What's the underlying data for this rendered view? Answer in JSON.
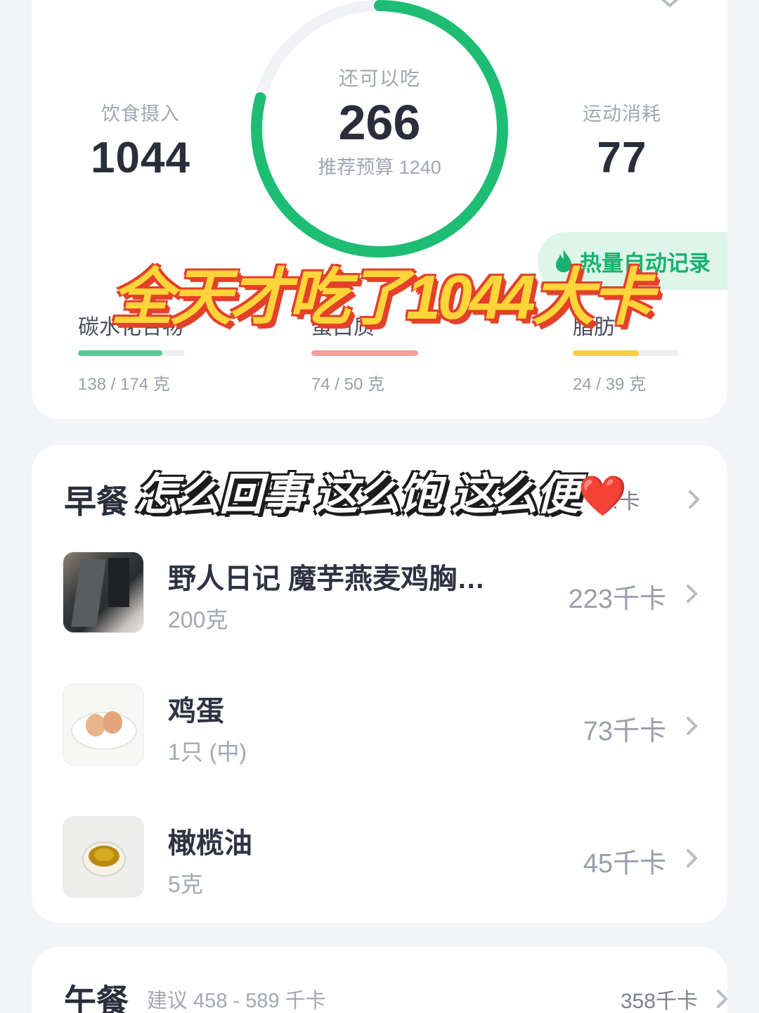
{
  "summary": {
    "intake_label": "饮食摄入",
    "intake_value": "1044",
    "remaining_label": "还可以吃",
    "remaining_value": "266",
    "budget_text": "推荐预算 1240",
    "remaining_fraction": 0.79,
    "burn_label": "运动消耗",
    "burn_value": "77",
    "auto_record_label": "热量自动记录",
    "ring_color": "#1dbd74"
  },
  "macros": [
    {
      "name": "碳水化合物",
      "amount": "138 / 174 克",
      "fraction": 0.79,
      "color": "#56c98e"
    },
    {
      "name": "蛋白质",
      "amount": "74 / 50 克",
      "fraction": 1.0,
      "color": "#f4a09a"
    },
    {
      "name": "脂肪",
      "amount": "24 / 39 克",
      "fraction": 0.62,
      "color": "#f7cf3e"
    }
  ],
  "overlays": {
    "headline": "全天才吃了1044大卡",
    "subline": "怎么回事 这么饱 这么便",
    "heart": "❤️"
  },
  "breakfast": {
    "title": "早餐",
    "total": "…卡",
    "items": [
      {
        "name": "野人日记 魔芋燕麦鸡胸…",
        "amount": "200克",
        "kcal": "223千卡",
        "icon": "packaged-food-thumb"
      },
      {
        "name": "鸡蛋",
        "amount": "1只 (中)",
        "kcal": "73千卡",
        "icon": "egg-thumb"
      },
      {
        "name": "橄榄油",
        "amount": "5克",
        "kcal": "45千卡",
        "icon": "olive-oil-thumb"
      }
    ]
  },
  "lunch": {
    "title": "午餐",
    "suggest": "建议 458 - 589 千卡",
    "total": "358千卡"
  }
}
